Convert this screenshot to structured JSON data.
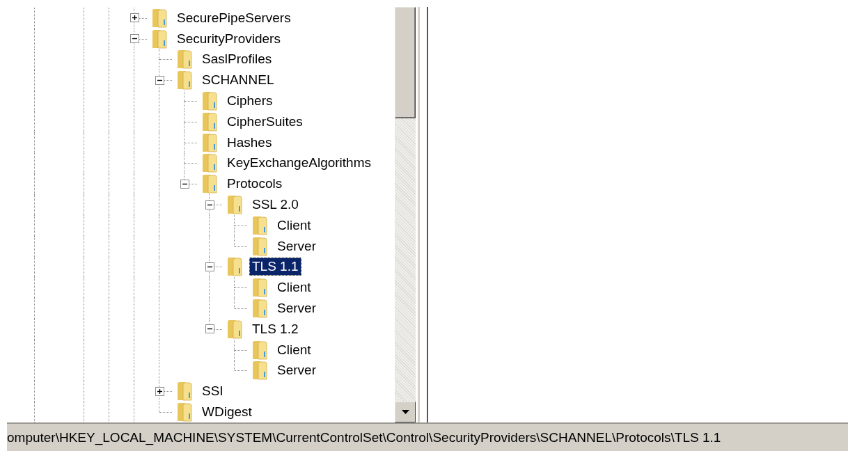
{
  "tree": {
    "items": [
      {
        "label": "SecurePipeServers",
        "kind": "collapsed",
        "selected": false
      },
      {
        "label": "SecurityProviders",
        "kind": "expanded",
        "selected": false,
        "children": [
          {
            "label": "SaslProfiles",
            "kind": "leaf",
            "selected": false
          },
          {
            "label": "SCHANNEL",
            "kind": "expanded",
            "selected": false,
            "children": [
              {
                "label": "Ciphers",
                "kind": "leaf",
                "selected": false
              },
              {
                "label": "CipherSuites",
                "kind": "leaf",
                "selected": false
              },
              {
                "label": "Hashes",
                "kind": "leaf",
                "selected": false
              },
              {
                "label": "KeyExchangeAlgorithms",
                "kind": "leaf",
                "selected": false
              },
              {
                "label": "Protocols",
                "kind": "expanded",
                "selected": false,
                "children": [
                  {
                    "label": "SSL 2.0",
                    "kind": "expanded",
                    "selected": false,
                    "children": [
                      {
                        "label": "Client",
                        "kind": "leaf",
                        "selected": false
                      },
                      {
                        "label": "Server",
                        "kind": "leaf",
                        "selected": false
                      }
                    ]
                  },
                  {
                    "label": "TLS 1.1",
                    "kind": "expanded",
                    "selected": true,
                    "children": [
                      {
                        "label": "Client",
                        "kind": "leaf",
                        "selected": false
                      },
                      {
                        "label": "Server",
                        "kind": "leaf",
                        "selected": false
                      }
                    ]
                  },
                  {
                    "label": "TLS 1.2",
                    "kind": "expanded",
                    "selected": false,
                    "children": [
                      {
                        "label": "Client",
                        "kind": "leaf",
                        "selected": false
                      },
                      {
                        "label": "Server",
                        "kind": "leaf",
                        "selected": false
                      }
                    ]
                  }
                ]
              }
            ]
          },
          {
            "label": "SSI",
            "kind": "collapsed",
            "selected": false
          },
          {
            "label": "WDigest",
            "kind": "leaf",
            "selected": false
          }
        ]
      }
    ]
  },
  "status_bar": {
    "path": "omputer\\HKEY_LOCAL_MACHINE\\SYSTEM\\CurrentControlSet\\Control\\SecurityProviders\\SCHANNEL\\Protocols\\TLS 1.1"
  }
}
